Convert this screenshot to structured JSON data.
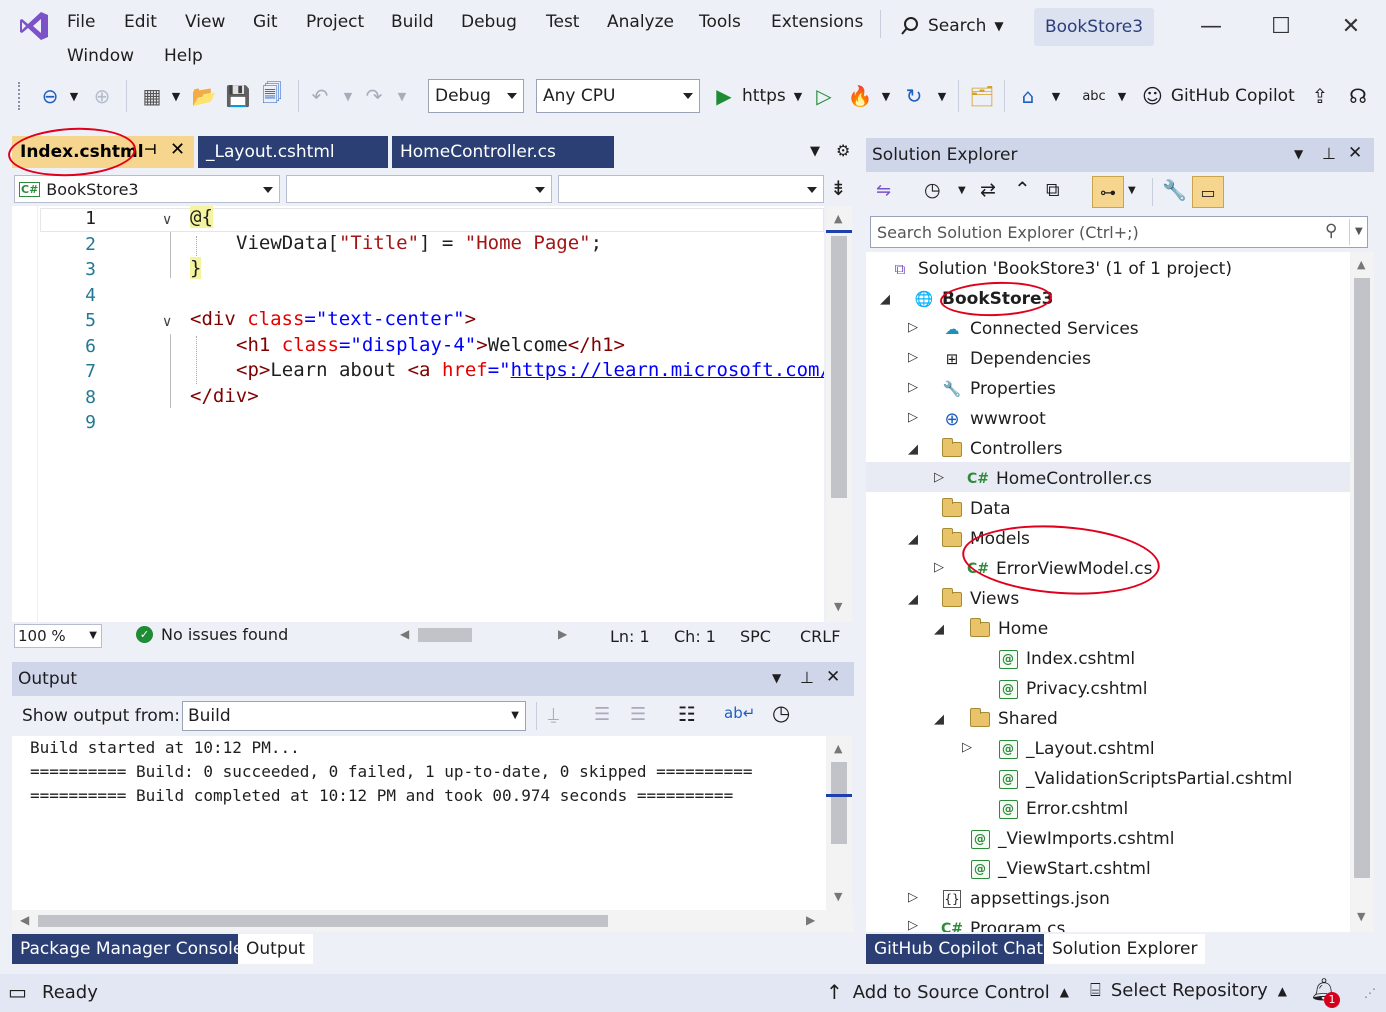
{
  "menu": {
    "row1": [
      "File",
      "Edit",
      "View",
      "Git",
      "Project",
      "Build",
      "Debug",
      "Test",
      "Analyze",
      "Tools",
      "Extensions"
    ],
    "row2": [
      "Window",
      "Help"
    ],
    "search_label": "Search",
    "project_name": "BookStore3"
  },
  "toolbar": {
    "config": "Debug",
    "platform": "Any CPU",
    "run_profile": "https",
    "copilot_label": "GitHub Copilot"
  },
  "editor": {
    "tabs": [
      {
        "label": "Index.cshtml",
        "active": true
      },
      {
        "label": "_Layout.cshtml",
        "active": false
      },
      {
        "label": "HomeController.cs",
        "active": false
      }
    ],
    "nav_project": "BookStore3",
    "lines": [
      "1",
      "2",
      "3",
      "4",
      "5",
      "6",
      "7",
      "8",
      "9"
    ],
    "code": {
      "l1": "@{",
      "l2_a": "ViewData[",
      "l2_b": "\"Title\"",
      "l2_c": "] = ",
      "l2_d": "\"Home Page\"",
      "l2_e": ";",
      "l3": "}",
      "l5_a": "<div ",
      "l5_b": "class",
      "l5_c": "=",
      "l5_d": "\"text-center\"",
      "l5_e": ">",
      "l6_a": "<h1 ",
      "l6_b": "class",
      "l6_c": "=",
      "l6_d": "\"display-4\"",
      "l6_e": ">",
      "l6_f": "Welcome",
      "l6_g": "</h1>",
      "l7_a": "<p>",
      "l7_b": "Learn about ",
      "l7_c": "<a ",
      "l7_d": "href",
      "l7_e": "=\"",
      "l7_f": "https://learn.microsoft.com/",
      "l8": "</div>"
    },
    "status": {
      "zoom": "100 %",
      "issues": "No issues found",
      "ln": "Ln: 1",
      "ch": "Ch: 1",
      "spc": "SPC",
      "crlf": "CRLF"
    }
  },
  "output": {
    "title": "Output",
    "show_from_label": "Show output from:",
    "source": "Build",
    "lines": [
      "Build started at 10:12 PM...",
      "========== Build: 0 succeeded, 0 failed, 1 up-to-date, 0 skipped ==========",
      "========== Build completed at 10:12 PM and took 00.974 seconds =========="
    ],
    "tabs": [
      "Package Manager Console",
      "Output"
    ]
  },
  "solution_explorer": {
    "title": "Solution Explorer",
    "search_placeholder": "Search Solution Explorer (Ctrl+;)",
    "tree": {
      "solution": "Solution 'BookStore3' (1 of 1 project)",
      "project": "BookStore3",
      "connected": "Connected Services",
      "dependencies": "Dependencies",
      "properties": "Properties",
      "wwwroot": "wwwroot",
      "controllers": "Controllers",
      "homecontroller": "HomeController.cs",
      "data": "Data",
      "models": "Models",
      "errorviewmodel": "ErrorViewModel.cs",
      "views": "Views",
      "home": "Home",
      "index": "Index.cshtml",
      "privacy": "Privacy.cshtml",
      "shared": "Shared",
      "layout": "_Layout.cshtml",
      "validation": "_ValidationScriptsPartial.cshtml",
      "error": "Error.cshtml",
      "viewimports": "_ViewImports.cshtml",
      "viewstart": "_ViewStart.cshtml",
      "appsettings": "appsettings.json",
      "program": "Program.cs"
    },
    "tabs": [
      "GitHub Copilot Chat",
      "Solution Explorer"
    ]
  },
  "statusbar": {
    "ready": "Ready",
    "source_control": "Add to Source Control",
    "repository": "Select Repository",
    "notifications": "1"
  },
  "colors": {
    "accent": "#2a3f7a",
    "tab_bar": "#2b3f75",
    "active_tab": "#f6d58e",
    "annotation": "#e0001b"
  }
}
